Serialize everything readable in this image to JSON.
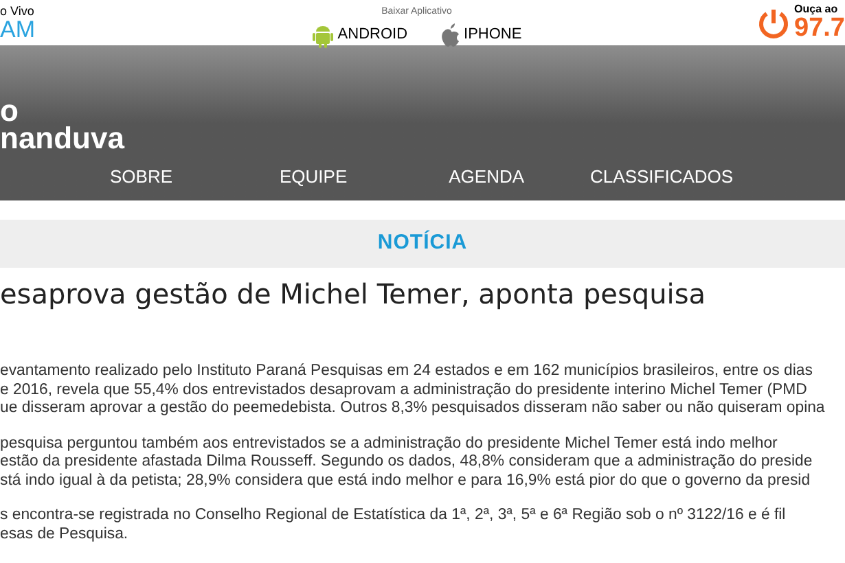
{
  "top_bar": {
    "live_label": "o Vivo",
    "station_logo": "AM",
    "app_label": "Baixar Aplicativo",
    "app_links": [
      {
        "label": "ANDROID",
        "kind": "android"
      },
      {
        "label": "IPHONE",
        "kind": "apple"
      }
    ],
    "listen_label": "Ouça ao",
    "frequency": "97.7"
  },
  "header": {
    "site_name_lines": [
      "o",
      "nanduva"
    ],
    "nav": [
      "SOBRE",
      "EQUIPE",
      "AGENDA",
      "CLASSIFICADOS"
    ]
  },
  "section_title": "NOTÍCIA",
  "article": {
    "title": "esaprova gestão de Michel Temer, aponta pesquisa",
    "paragraphs": [
      [
        "evantamento realizado pelo Instituto Paraná Pesquisas em 24 estados e em 162 municípios brasileiros, entre os dias",
        "e 2016, revela que 55,4% dos entrevistados desaprovam a administração do presidente interino Michel Temer (PMD",
        "ue disseram aprovar a gestão do peemedebista. Outros 8,3% pesquisados disseram não saber ou não quiseram opina"
      ],
      [
        "pesquisa perguntou também aos entrevistados se a administração do presidente Michel Temer está indo melhor",
        "estão da presidente afastada Dilma Rousseff. Segundo os dados, 48,8% consideram que a administração do preside",
        "stá indo igual à da petista; 28,9% considera que está indo melhor e para 16,9% está pior do que o governo da presid"
      ],
      [
        "s encontra-se registrada no Conselho Regional de Estatística da 1ª, 2ª, 3ª, 5ª e 6ª Região sob o nº 3122/16 e é fil",
        "esas de Pesquisa."
      ]
    ]
  }
}
